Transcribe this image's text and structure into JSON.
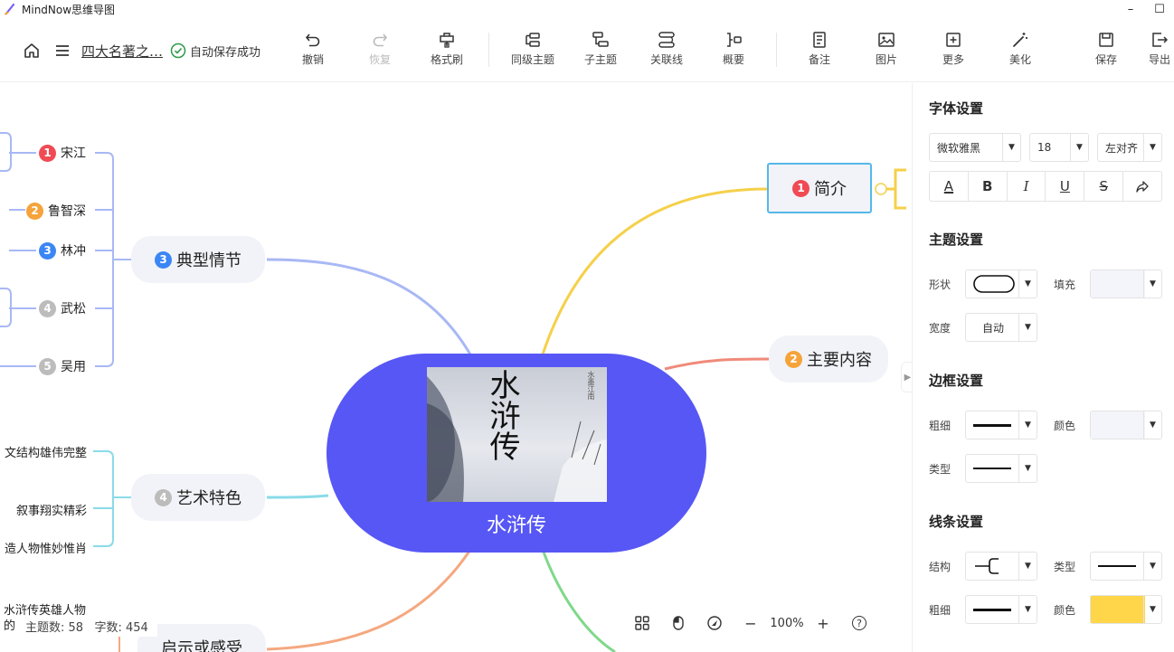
{
  "app": {
    "title": "MindNow思维导图"
  },
  "window": {
    "minimize": "–",
    "maximize": "☐"
  },
  "toolbar": {
    "doc_title": "四大名著之…",
    "save_status": "自动保存成功",
    "tools": {
      "undo": "撤销",
      "redo": "恢复",
      "format_brush": "格式刷",
      "sibling_topic": "同级主题",
      "child_topic": "子主题",
      "relation_line": "关联线",
      "summary": "概要",
      "note": "备注",
      "image": "图片",
      "more": "更多",
      "beautify": "美化",
      "save": "保存",
      "export": "导出"
    }
  },
  "mindmap": {
    "central": {
      "label": "水浒传",
      "image_text": "水浒传",
      "image_side_text": "水墨江南"
    },
    "branches": [
      {
        "num": "1",
        "label": "简介",
        "color": "#f5d04a"
      },
      {
        "num": "2",
        "label": "主要内容",
        "color": "#f08a7a"
      },
      {
        "num": "3",
        "label": "典型情节",
        "color": "#a8b8f5"
      },
      {
        "num": "4",
        "label": "艺术特色",
        "color": "#8adbe8"
      },
      {
        "label": "启示或感受",
        "color": "#f5a880"
      }
    ],
    "plot_leaves": [
      {
        "num": "1",
        "label": "宋江"
      },
      {
        "num": "2",
        "label": "鲁智深"
      },
      {
        "num": "3",
        "label": "林冲"
      },
      {
        "num": "4",
        "label": "武松"
      },
      {
        "num": "5",
        "label": "吴用"
      }
    ],
    "art_leaves": [
      {
        "label": "文结构雄伟完整"
      },
      {
        "label": "叙事翔实精彩"
      },
      {
        "label": "造人物惟妙惟肖"
      }
    ],
    "insight_leaf": {
      "line1": "水浒传英雄人物",
      "line2": "的"
    },
    "badge_colors": {
      "red": "#f04b55",
      "orange": "#f5a33a",
      "blue": "#3b86f5",
      "gray": "#bcbcbc"
    }
  },
  "statusbar": {
    "topics": "主题数: 58",
    "words": "字数: 454"
  },
  "zoom": {
    "level": "100%",
    "minus": "−",
    "plus": "+",
    "help": "?"
  },
  "panel": {
    "font": {
      "title": "字体设置",
      "family": "微软雅黑",
      "size": "18",
      "align": "左对齐",
      "bold": "B",
      "italic": "I",
      "underline": "U",
      "strike": "S",
      "color_letter": "A"
    },
    "topic": {
      "title": "主题设置",
      "shape_label": "形状",
      "fill_label": "填充",
      "width_label": "宽度",
      "width_value": "自动",
      "fill_color": "#f4f5fb"
    },
    "border": {
      "title": "边框设置",
      "thickness_label": "粗细",
      "color_label": "颜色",
      "type_label": "类型",
      "color": "#f4f5fb"
    },
    "line": {
      "title": "线条设置",
      "structure_label": "结构",
      "type_label": "类型",
      "thickness_label": "粗细",
      "color_label": "颜色",
      "color": "#ffd54a"
    }
  }
}
